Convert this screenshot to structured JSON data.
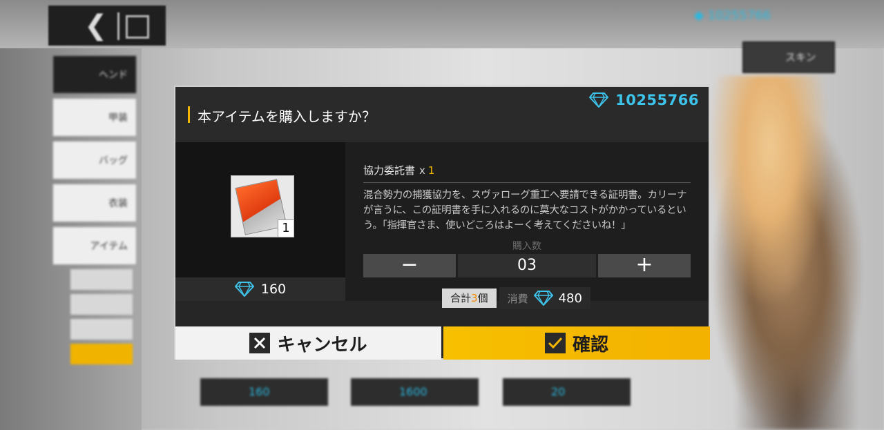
{
  "background": {
    "top_balance": "10255766",
    "skin_button": "スキン",
    "sidebar": [
      "ヘンド",
      "甲装",
      "バッグ",
      "衣装",
      "アイテム"
    ],
    "shop_prices": [
      "160",
      "1600",
      "20"
    ]
  },
  "dialog": {
    "title": "本アイテムを購入しますか？",
    "balance": "10255766",
    "item": {
      "name": "協力委託書",
      "multiplier": "x",
      "count": "1",
      "tile_qty": "1",
      "unit_price": "160",
      "description": "混合勢力の捕獲協力を、スヴァローグ重工へ要請できる証明書。カリーナが言うに、この証明書を手に入れるのに莫大なコストがかかっているという。「指揮官さま、使いどころはよーく考えてくださいね！」"
    },
    "quantity": {
      "label": "購入数",
      "value": "03",
      "minus": "−",
      "plus": "+"
    },
    "summary": {
      "total_prefix": "合計",
      "total_count": "3",
      "total_suffix": "個",
      "cost_label": "消費",
      "cost_value": "480"
    },
    "buttons": {
      "cancel": "キャンセル",
      "confirm": "確認"
    }
  },
  "colors": {
    "accent": "#f5b700",
    "gem": "#3ec3ea",
    "panel": "#262626"
  }
}
